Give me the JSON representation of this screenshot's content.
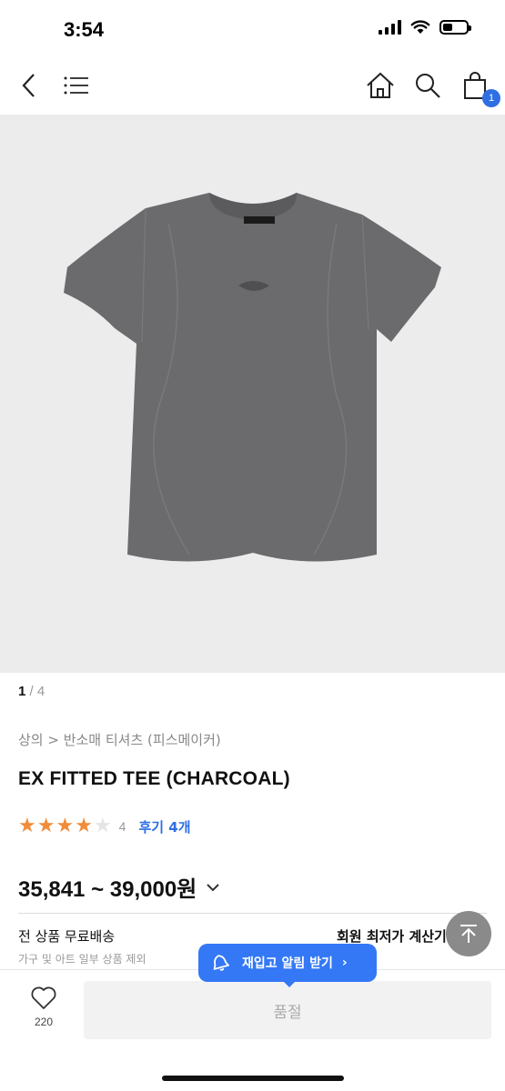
{
  "status_bar": {
    "time": "3:54"
  },
  "nav": {
    "cart_count": "1"
  },
  "gallery": {
    "current": "1",
    "separator": "/",
    "total": "4"
  },
  "product": {
    "breadcrumb": "상의 > 반소매 티셔츠 (피스메이커)",
    "title": "EX FITTED TEE (CHARCOAL)",
    "rating": 4,
    "rating_text": "4",
    "review_link": "후기 4개",
    "price": "35,841 ~ 39,000원",
    "garment_color": "#6b6b6e"
  },
  "shipping": {
    "title": "전 상품 무료배송",
    "subtitle": "가구 및 아트 일부 상품 제외",
    "member_price": "회원 최저가 계산기"
  },
  "restock": {
    "label": "재입고 알림 받기",
    "chevron": "›"
  },
  "bottom_bar": {
    "like_count": "220",
    "soldout_label": "품절"
  },
  "colors": {
    "accent": "#2f6fe4",
    "star": "#f08c3a"
  }
}
